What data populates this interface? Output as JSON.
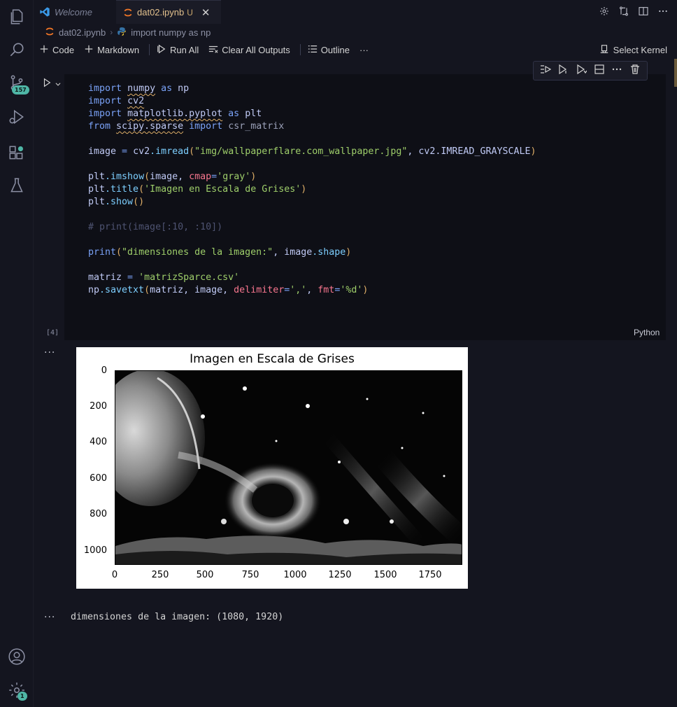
{
  "activity_bar": {
    "scm_badge": "157",
    "settings_badge": "1"
  },
  "tabs": [
    {
      "label": "Welcome"
    },
    {
      "label": "dat02.ipynb",
      "status": "U"
    }
  ],
  "breadcrumb": {
    "file": "dat02.ipynb",
    "symbol": "import numpy as np"
  },
  "toolbar": {
    "code": "Code",
    "markdown": "Markdown",
    "run_all": "Run All",
    "clear_outputs": "Clear All Outputs",
    "outline": "Outline",
    "more": "···",
    "select_kernel": "Select Kernel"
  },
  "cell": {
    "execution_count": "[4]",
    "language": "Python",
    "code": {
      "l1": {
        "a": "import",
        "b": "numpy",
        "c": "as",
        "d": "np"
      },
      "l2": {
        "a": "import",
        "b": "cv2"
      },
      "l3": {
        "a": "import",
        "b": "matplotlib.pyplot",
        "c": "as",
        "d": "plt"
      },
      "l4": {
        "a": "from",
        "b": "scipy.sparse",
        "c": "import",
        "d": "csr_matrix"
      },
      "l5": {
        "a": "image",
        "b": " = ",
        "c": "cv2",
        "d": ".imread",
        "e": "(",
        "f": "\"img/wallpaperflare.com_wallpaper.jpg\"",
        "g": ", cv2.IMREAD_GRAYSCALE",
        "h": ")"
      },
      "l6": {
        "a": "plt",
        "b": ".imshow",
        "c": "(",
        "d": "image, ",
        "e": "cmap",
        "f": "=",
        "g": "'gray'",
        "h": ")"
      },
      "l7": {
        "a": "plt",
        "b": ".title",
        "c": "(",
        "d": "'Imagen en Escala de Grises'",
        "e": ")"
      },
      "l8": {
        "a": "plt",
        "b": ".show",
        "c": "()"
      },
      "l9": "# print(image[:10, :10])",
      "l10": {
        "a": "print",
        "b": "(",
        "c": "\"dimensiones de la imagen:\"",
        "d": ", image",
        "e": ".shape",
        "f": ")"
      },
      "l11": {
        "a": "matriz",
        "b": " = ",
        "c": "'matrizSparce.csv'"
      },
      "l12": {
        "a": "np",
        "b": ".savetxt",
        "c": "(",
        "d": "matriz, image, ",
        "e": "delimiter",
        "f": "=",
        "g": "','",
        "h": ", ",
        "i": "fmt",
        "j": "=",
        "k": "'%d'",
        "l": ")"
      }
    }
  },
  "output": {
    "more": "···",
    "plot": {
      "title": "Imagen en Escala de Grises",
      "yticks": [
        "0",
        "200",
        "400",
        "600",
        "800",
        "1000"
      ],
      "xticks": [
        "0",
        "250",
        "500",
        "750",
        "1000",
        "1250",
        "1500",
        "1750"
      ]
    },
    "stream": "dimensiones de la imagen: (1080, 1920)"
  }
}
